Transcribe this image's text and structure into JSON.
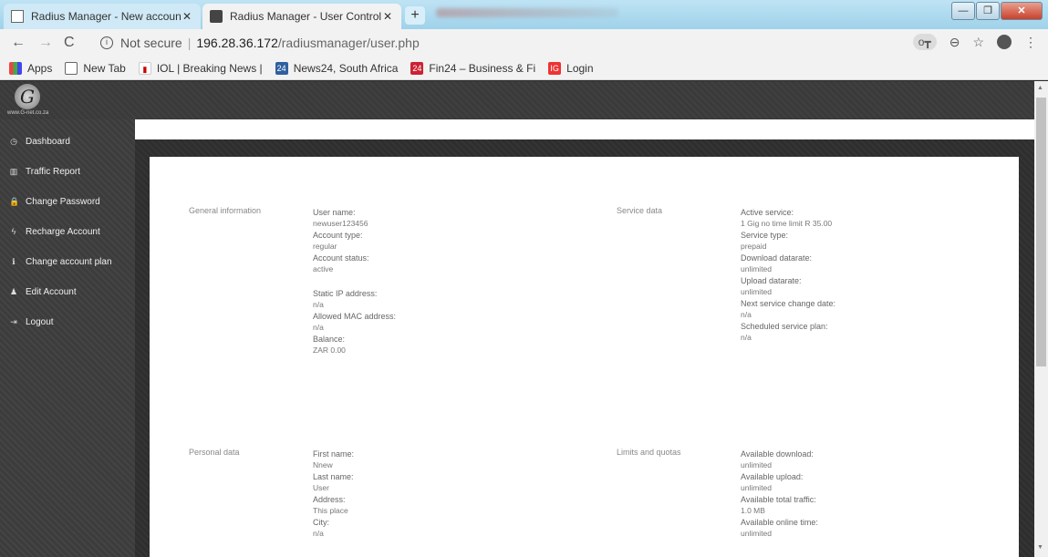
{
  "browser": {
    "tabs": [
      {
        "title": "Radius Manager - New account i",
        "close": "✕"
      },
      {
        "title": "Radius Manager - User Control P",
        "close": "✕"
      }
    ],
    "new_tab": "+",
    "window_controls": {
      "min": "—",
      "max": "❐",
      "close": "✕"
    },
    "nav": {
      "back": "←",
      "forward": "→",
      "reload": "C"
    },
    "url": {
      "info": "i",
      "secure_label": "Not secure",
      "sep": "|",
      "host": "196.28.36.172",
      "path": "/radiusmanager/user.php"
    },
    "addr_icons": {
      "key": "o┳",
      "zoom": "⊖",
      "star": "☆",
      "menu": "⋮"
    },
    "bookmarks": [
      {
        "label": "Apps",
        "icon": "apps-grid-icon"
      },
      {
        "label": "New Tab",
        "icon": "page-icon"
      },
      {
        "label": "IOL | Breaking News |",
        "icon": "iol-icon"
      },
      {
        "label": "News24, South Africa",
        "icon": "news24-icon"
      },
      {
        "label": "Fin24 – Business & Fi",
        "icon": "fin24-icon"
      },
      {
        "label": "Login",
        "icon": "login-icon"
      }
    ],
    "bookmark_glyphs": {
      "news24": "24",
      "fin24": "24",
      "login": "IG",
      "iol": "▮"
    }
  },
  "header": {
    "logo_glyph": "G",
    "logo_text": "www.G-net.co.za"
  },
  "sidebar": {
    "items": [
      {
        "label": "Dashboard",
        "icon": "◷"
      },
      {
        "label": "Traffic Report",
        "icon": "▥"
      },
      {
        "label": "Change Password",
        "icon": "🔒"
      },
      {
        "label": "Recharge Account",
        "icon": "ϟ"
      },
      {
        "label": "Change account plan",
        "icon": "ℹ"
      },
      {
        "label": "Edit Account",
        "icon": "♟"
      },
      {
        "label": "Logout",
        "icon": "⇥"
      }
    ]
  },
  "general": {
    "title": "General information",
    "user_name_label": "User name:",
    "user_name": "newuser123456",
    "account_type_label": "Account type:",
    "account_type": "regular",
    "account_status_label": "Account status:",
    "account_status": "active",
    "static_ip_label": "Static IP address:",
    "static_ip": "n/a",
    "mac_label": "Allowed MAC address:",
    "mac": "n/a",
    "balance_label": "Balance:",
    "balance": "ZAR 0.00"
  },
  "service": {
    "title": "Service data",
    "active_label": "Active service:",
    "active": "1 Gig no time limit R 35.00",
    "type_label": "Service type:",
    "type": "prepaid",
    "download_label": "Download datarate:",
    "download": "unlimited",
    "upload_label": "Upload datarate:",
    "upload": "unlimited",
    "next_change_label": "Next service change date:",
    "next_change": "n/a",
    "scheduled_label": "Scheduled service plan:",
    "scheduled": "n/a"
  },
  "personal": {
    "title": "Personal data",
    "first_name_label": "First name:",
    "first_name": "Nnew",
    "last_name_label": "Last name:",
    "last_name": "User",
    "address_label": "Address:",
    "address": "This place",
    "city_label": "City:",
    "city": "n/a"
  },
  "limits": {
    "title": "Limits and quotas",
    "avail_download_label": "Available download:",
    "avail_download": "unlimited",
    "avail_upload_label": "Available upload:",
    "avail_upload": "unlimited",
    "avail_total_label": "Available total traffic:",
    "avail_total": "1.0 MB",
    "avail_online_label": "Available online time:",
    "avail_online": "unlimited"
  },
  "scrollbar": {
    "up": "▲",
    "down": "▼"
  }
}
